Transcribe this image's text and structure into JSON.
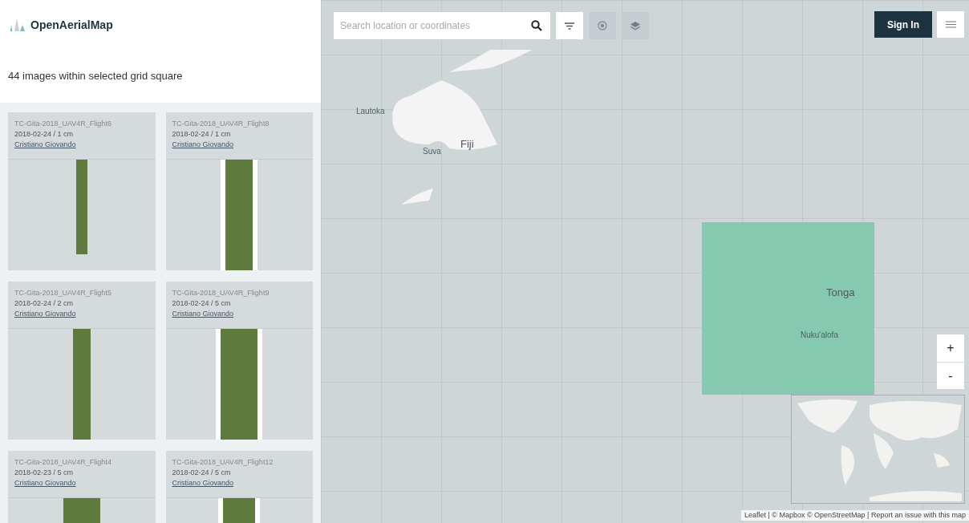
{
  "brand": "OpenAerialMap",
  "results": {
    "heading": "44 images within selected grid square",
    "cards": [
      {
        "title": "TC-Gita-2018_UAV4R_Flight6",
        "meta": "2018-02-24 / 1 cm",
        "author": "Cristiano Giovando"
      },
      {
        "title": "TC-Gita-2018_UAV4R_Flight8",
        "meta": "2018-02-24 / 1 cm",
        "author": "Cristiano Giovando"
      },
      {
        "title": "TC-Gita-2018_UAV4R_Flight5",
        "meta": "2018-02-24 / 2 cm",
        "author": "Cristiano Giovando"
      },
      {
        "title": "TC-Gita-2018_UAV4R_Flight9",
        "meta": "2018-02-24 / 5 cm",
        "author": "Cristiano Giovando"
      },
      {
        "title": "TC-Gita-2018_UAV4R_Flight4",
        "meta": "2018-02-23 / 5 cm",
        "author": "Cristiano Giovando"
      },
      {
        "title": "TC-Gita-2018_UAV4R_Flight12",
        "meta": "2018-02-24 / 5 cm",
        "author": "Cristiano Giovando"
      }
    ]
  },
  "search": {
    "placeholder": "Search location or coordinates"
  },
  "sign_in": "Sign In",
  "map": {
    "labels": [
      {
        "text": "Lautoka",
        "kind": "city"
      },
      {
        "text": "Suva",
        "kind": "city"
      },
      {
        "text": "Fiji",
        "kind": "country"
      },
      {
        "text": "Tonga",
        "kind": "country"
      },
      {
        "text": "Nuku'alofa",
        "kind": "city"
      }
    ],
    "zoom": [
      "+",
      "-"
    ],
    "attribution": "Leaflet | © Mapbox © OpenStreetMap | Report an issue with this map"
  }
}
